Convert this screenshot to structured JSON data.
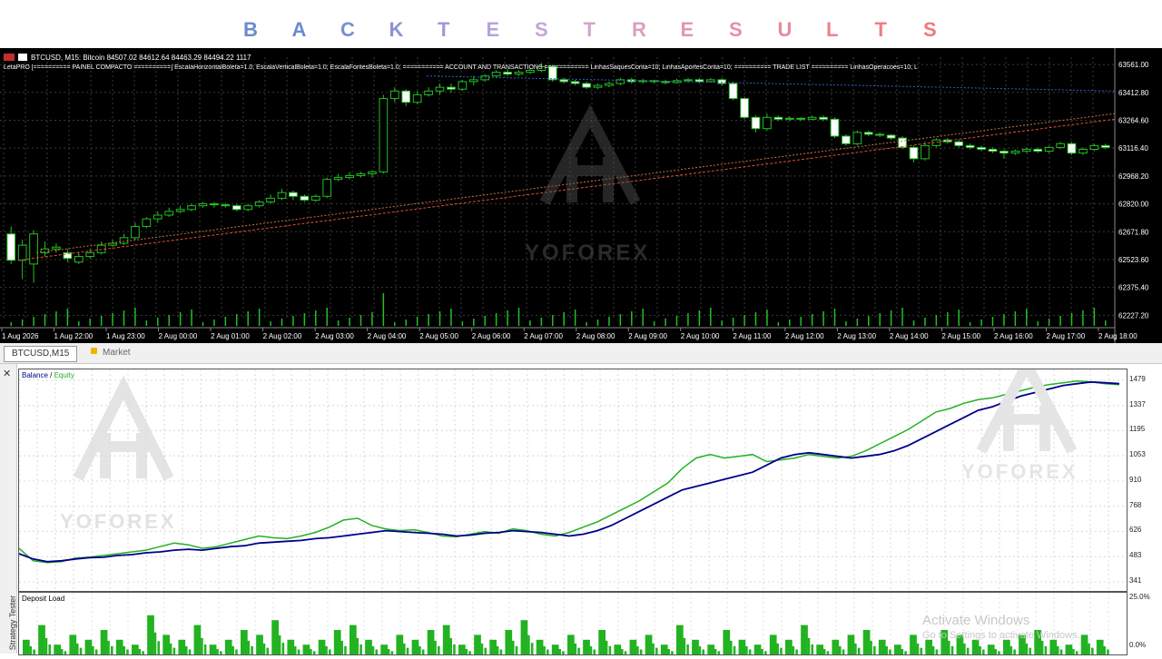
{
  "title": {
    "letters": [
      "B",
      "A",
      "C",
      "K",
      "T",
      "E",
      "S",
      "T",
      "R",
      "E",
      "S",
      "U",
      "L",
      "T",
      "S"
    ],
    "colors": [
      "#6a8ccd",
      "#6a8ccd",
      "#7b8fd0",
      "#8c93d4",
      "#a09ad8",
      "#b5a4dc",
      "#c5a6d6",
      "#d2a6cc",
      "#dc9fbf",
      "#e198b2",
      "#e590a6",
      "#e88a9a",
      "#ea8490",
      "#ec7f87",
      "#ee7a7e"
    ]
  },
  "chart": {
    "symbol_text": "BTCUSD, M15:  Bitcoin  84507.02 84612.64 84463.29 84494.22  1117",
    "indicator_text": "LetaPRO [========== PAINEL COMPACTO ==========] EscalaHorizontalBoleta=1.0; EscalaVerticalBoleta=1.0; EscalaFontesBoleta=1.0; =========== ACCOUNT AND TRANSACTIONS ============ LinhasSaquesConta=10; LinhasAportesConta=10; ========== TRADE LIST ========== LinhasOperacoes=10; L",
    "price_labels": [
      "63561.00",
      "63412.80",
      "63264.60",
      "63116.40",
      "62968.20",
      "62820.00",
      "62671.80",
      "62523.60",
      "62375.40",
      "62227.20"
    ],
    "time_labels": [
      "1 Aug 2026",
      "1 Aug 22:00",
      "1 Aug 23:00",
      "2 Aug 00:00",
      "2 Aug 01:00",
      "2 Aug 02:00",
      "2 Aug 03:00",
      "2 Aug 04:00",
      "2 Aug 05:00",
      "2 Aug 06:00",
      "2 Aug 07:00",
      "2 Aug 08:00",
      "2 Aug 09:00",
      "2 Aug 10:00",
      "2 Aug 11:00",
      "2 Aug 12:00",
      "2 Aug 13:00",
      "2 Aug 14:00",
      "2 Aug 15:00",
      "2 Aug 16:00",
      "2 Aug 17:00",
      "2 Aug 18:00"
    ],
    "candles": [
      [
        62660,
        62520,
        62700,
        62500
      ],
      [
        62520,
        62600,
        62630,
        62420
      ],
      [
        62500,
        62660,
        62680,
        62400
      ],
      [
        62560,
        62580,
        62620,
        62540
      ],
      [
        62580,
        62590,
        62610,
        62560
      ],
      [
        62560,
        62530,
        62580,
        62510
      ],
      [
        62510,
        62540,
        62560,
        62500
      ],
      [
        62540,
        62560,
        62580,
        62530
      ],
      [
        62560,
        62600,
        62620,
        62550
      ],
      [
        62600,
        62610,
        62630,
        62590
      ],
      [
        62610,
        62640,
        62660,
        62600
      ],
      [
        62640,
        62700,
        62720,
        62630
      ],
      [
        62700,
        62740,
        62750,
        62690
      ],
      [
        62740,
        62760,
        62780,
        62720
      ],
      [
        62760,
        62780,
        62800,
        62750
      ],
      [
        62780,
        62790,
        62810,
        62770
      ],
      [
        62790,
        62810,
        62820,
        62780
      ],
      [
        62810,
        62820,
        62830,
        62800
      ],
      [
        62820,
        62815,
        62830,
        62800
      ],
      [
        62815,
        62810,
        62825,
        62800
      ],
      [
        62810,
        62790,
        62820,
        62780
      ],
      [
        62790,
        62810,
        62820,
        62780
      ],
      [
        62810,
        62830,
        62840,
        62800
      ],
      [
        62830,
        62850,
        62870,
        62820
      ],
      [
        62850,
        62880,
        62900,
        62840
      ],
      [
        62880,
        62860,
        62890,
        62840
      ],
      [
        62860,
        62840,
        62870,
        62830
      ],
      [
        62840,
        62860,
        62870,
        62830
      ],
      [
        62860,
        62950,
        62960,
        62850
      ],
      [
        62950,
        62960,
        62980,
        62940
      ],
      [
        62960,
        62970,
        62990,
        62950
      ],
      [
        62970,
        62980,
        62990,
        62960
      ],
      [
        62980,
        62990,
        63000,
        62960
      ],
      [
        62990,
        63380,
        63400,
        62980
      ],
      [
        63380,
        63420,
        63440,
        63360
      ],
      [
        63420,
        63360,
        63430,
        63340
      ],
      [
        63360,
        63400,
        63420,
        63350
      ],
      [
        63400,
        63420,
        63440,
        63390
      ],
      [
        63420,
        63440,
        63460,
        63400
      ],
      [
        63440,
        63430,
        63460,
        63410
      ],
      [
        63430,
        63470,
        63480,
        63420
      ],
      [
        63470,
        63480,
        63500,
        63450
      ],
      [
        63480,
        63500,
        63510,
        63470
      ],
      [
        63500,
        63520,
        63530,
        63490
      ],
      [
        63520,
        63510,
        63540,
        63500
      ],
      [
        63510,
        63520,
        63530,
        63500
      ],
      [
        63520,
        63530,
        63540,
        63510
      ],
      [
        63530,
        63550,
        63570,
        63520
      ],
      [
        63550,
        63480,
        63560,
        63470
      ],
      [
        63480,
        63470,
        63490,
        63460
      ],
      [
        63470,
        63460,
        63480,
        63450
      ],
      [
        63460,
        63440,
        63470,
        63430
      ],
      [
        63440,
        63450,
        63460,
        63430
      ],
      [
        63450,
        63460,
        63470,
        63440
      ],
      [
        63460,
        63480,
        63490,
        63450
      ],
      [
        63480,
        63470,
        63490,
        63460
      ],
      [
        63470,
        63475,
        63485,
        63460
      ],
      [
        63475,
        63470,
        63480,
        63460
      ],
      [
        63470,
        63465,
        63480,
        63455
      ],
      [
        63465,
        63475,
        63485,
        63460
      ],
      [
        63475,
        63480,
        63490,
        63465
      ],
      [
        63480,
        63470,
        63490,
        63460
      ],
      [
        63470,
        63480,
        63490,
        63465
      ],
      [
        63480,
        63460,
        63490,
        63450
      ],
      [
        63460,
        63380,
        63470,
        63370
      ],
      [
        63380,
        63280,
        63390,
        63270
      ],
      [
        63280,
        63220,
        63290,
        63200
      ],
      [
        63220,
        63280,
        63300,
        63210
      ],
      [
        63280,
        63270,
        63290,
        63260
      ],
      [
        63270,
        63275,
        63285,
        63260
      ],
      [
        63275,
        63270,
        63280,
        63260
      ],
      [
        63270,
        63280,
        63290,
        63265
      ],
      [
        63280,
        63270,
        63290,
        63260
      ],
      [
        63270,
        63180,
        63280,
        63170
      ],
      [
        63180,
        63140,
        63190,
        63130
      ],
      [
        63140,
        63200,
        63210,
        63130
      ],
      [
        63200,
        63190,
        63210,
        63180
      ],
      [
        63190,
        63185,
        63200,
        63175
      ],
      [
        63185,
        63170,
        63190,
        63160
      ],
      [
        63170,
        63120,
        63180,
        63110
      ],
      [
        63120,
        63060,
        63130,
        63040
      ],
      [
        63060,
        63130,
        63150,
        63050
      ],
      [
        63130,
        63160,
        63170,
        63120
      ],
      [
        63160,
        63150,
        63170,
        63140
      ],
      [
        63150,
        63130,
        63160,
        63120
      ],
      [
        63130,
        63120,
        63140,
        63110
      ],
      [
        63120,
        63110,
        63130,
        63100
      ],
      [
        63110,
        63100,
        63120,
        63090
      ],
      [
        63100,
        63090,
        63110,
        63060
      ],
      [
        63090,
        63100,
        63110,
        63080
      ],
      [
        63100,
        63110,
        63120,
        63090
      ],
      [
        63110,
        63100,
        63120,
        63090
      ],
      [
        63100,
        63120,
        63130,
        63090
      ],
      [
        63120,
        63140,
        63150,
        63110
      ],
      [
        63140,
        63090,
        63150,
        63080
      ],
      [
        63090,
        63110,
        63120,
        63080
      ],
      [
        63110,
        63130,
        63140,
        63100
      ],
      [
        63130,
        63120,
        63140,
        63110
      ]
    ],
    "line_levels": {
      "high": 63420,
      "low": 62520
    }
  },
  "tabs": {
    "symbol": "BTCUSD,M15",
    "market": "Market"
  },
  "tester": {
    "close_glyph": "✕",
    "side_label": "Strategy Tester",
    "legend_balance": "Balance",
    "legend_sep": " / ",
    "legend_equity": "Equity",
    "deposit_label": "Deposit Load",
    "y_labels": [
      "1479",
      "1337",
      "1195",
      "1053",
      "910",
      "768",
      "626",
      "483",
      "341"
    ],
    "deposit_y_labels": [
      "25.0%",
      "0.0%"
    ],
    "colors": {
      "balance": "#00008b",
      "equity": "#22b222",
      "deposit": "#22b222"
    }
  },
  "chart_data": {
    "type": "line",
    "ylim": [
      341,
      1479
    ],
    "series": [
      {
        "name": "Balance",
        "values": [
          500,
          470,
          455,
          460,
          470,
          478,
          480,
          490,
          495,
          505,
          510,
          520,
          525,
          520,
          530,
          540,
          545,
          560,
          565,
          570,
          575,
          585,
          590,
          600,
          610,
          620,
          630,
          625,
          620,
          615,
          610,
          600,
          605,
          615,
          620,
          630,
          625,
          620,
          610,
          600,
          610,
          630,
          660,
          700,
          740,
          780,
          820,
          860,
          880,
          900,
          920,
          940,
          960,
          1000,
          1040,
          1060,
          1070,
          1060,
          1050,
          1040,
          1050,
          1060,
          1080,
          1110,
          1150,
          1190,
          1230,
          1270,
          1310,
          1330,
          1360,
          1390,
          1410,
          1430,
          1450,
          1460,
          1470,
          1465,
          1460
        ]
      },
      {
        "name": "Equity",
        "values": [
          530,
          460,
          450,
          455,
          475,
          480,
          490,
          500,
          510,
          520,
          540,
          560,
          550,
          530,
          540,
          560,
          580,
          600,
          590,
          585,
          600,
          620,
          650,
          690,
          700,
          660,
          640,
          630,
          635,
          620,
          600,
          595,
          610,
          625,
          615,
          640,
          630,
          610,
          600,
          620,
          650,
          680,
          720,
          760,
          800,
          850,
          900,
          980,
          1040,
          1060,
          1040,
          1050,
          1060,
          1020,
          1030,
          1040,
          1060,
          1050,
          1040,
          1050,
          1080,
          1120,
          1160,
          1200,
          1250,
          1300,
          1320,
          1350,
          1370,
          1380,
          1400,
          1420,
          1440,
          1455,
          1465,
          1475,
          1470,
          1460,
          1455
        ]
      }
    ]
  },
  "deposit_values": [
    0.3,
    0.6,
    0.2,
    0.4,
    0.3,
    0.5,
    0.3,
    0.2,
    0.8,
    0.4,
    0.3,
    0.6,
    0.2,
    0.3,
    0.5,
    0.4,
    0.7,
    0.3,
    0.2,
    0.3,
    0.5,
    0.6,
    0.3,
    0.2,
    0.4,
    0.3,
    0.5,
    0.6,
    0.2,
    0.4,
    0.3,
    0.5,
    0.7,
    0.3,
    0.2,
    0.4,
    0.3,
    0.5,
    0.2,
    0.3,
    0.4,
    0.2,
    0.6,
    0.3,
    0.2,
    0.5,
    0.3,
    0.2,
    0.4,
    0.3,
    0.6,
    0.2,
    0.3,
    0.4,
    0.5,
    0.3,
    0.2,
    0.4,
    0.3,
    0.5,
    0.4,
    0.3,
    0.2,
    0.3,
    0.4,
    0.5,
    0.3,
    0.2,
    0.4,
    0.3
  ],
  "watermarks": {
    "brand": "YOFOREX",
    "windows_line1": "Activate Windows",
    "windows_line2": "Go to Settings to activate Windows."
  }
}
